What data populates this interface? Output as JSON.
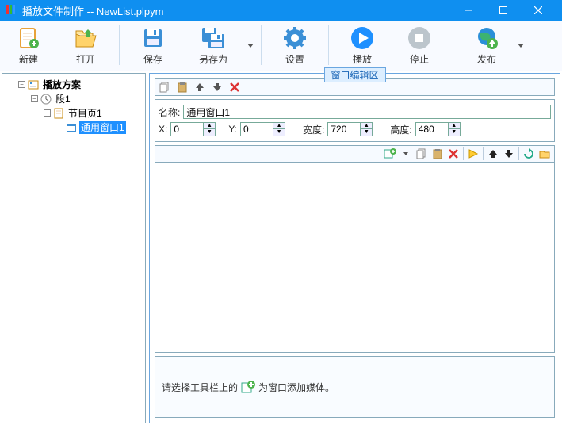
{
  "window": {
    "app_name": "播放文件制作",
    "separator": " -- ",
    "doc_name": "NewList.plpym"
  },
  "toolbar": {
    "new": "新建",
    "open": "打开",
    "save": "保存",
    "save_as": "另存为",
    "settings": "设置",
    "play": "播放",
    "stop": "停止",
    "publish": "发布"
  },
  "tree": {
    "root": "播放方案",
    "seg1": "段1",
    "page1": "节目页1",
    "win1": "通用窗口1"
  },
  "editor": {
    "group_title": "窗口编辑区",
    "name_label": "名称:",
    "name_value": "通用窗口1",
    "x_label": "X:",
    "x_value": "0",
    "y_label": "Y:",
    "y_value": "0",
    "w_label": "宽度:",
    "w_value": "720",
    "h_label": "高度:",
    "h_value": "480",
    "hint_before": "请选择工具栏上的",
    "hint_after": "为窗口添加媒体。"
  }
}
